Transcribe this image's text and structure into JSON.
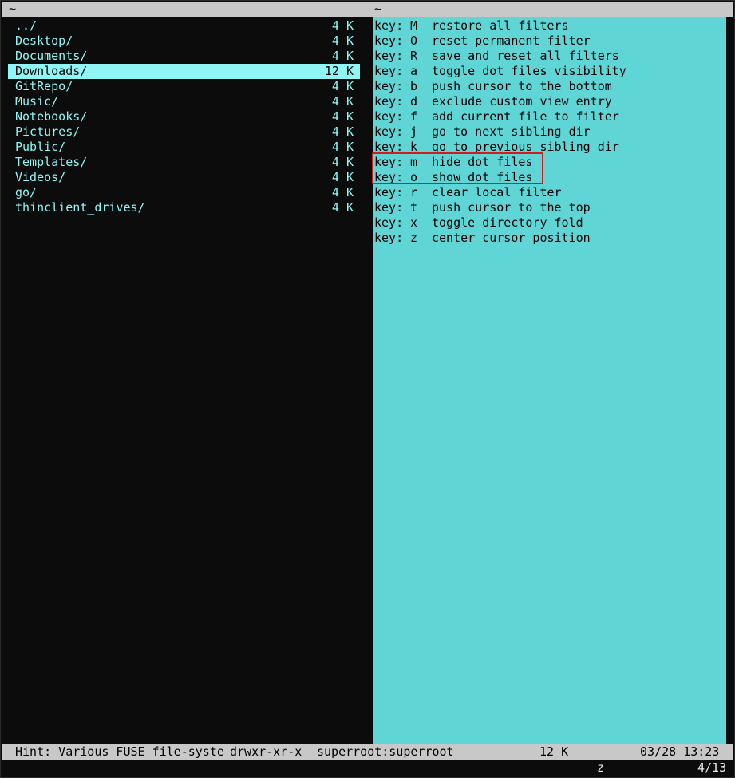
{
  "titlebar": {
    "left_path": "~",
    "right_path": "~"
  },
  "files": [
    {
      "name": "../",
      "size": "4 K"
    },
    {
      "name": "Desktop/",
      "size": "4 K"
    },
    {
      "name": "Documents/",
      "size": "4 K"
    },
    {
      "name": "Downloads/",
      "size": "12 K",
      "selected": true
    },
    {
      "name": "GitRepo/",
      "size": "4 K"
    },
    {
      "name": "Music/",
      "size": "4 K"
    },
    {
      "name": "Notebooks/",
      "size": "4 K"
    },
    {
      "name": "Pictures/",
      "size": "4 K"
    },
    {
      "name": "Public/",
      "size": "4 K"
    },
    {
      "name": "Templates/",
      "size": "4 K"
    },
    {
      "name": "Videos/",
      "size": "4 K"
    },
    {
      "name": "go/",
      "size": "4 K"
    },
    {
      "name": "thinclient_drives/",
      "size": "4 K"
    }
  ],
  "keys": [
    {
      "prefix": "key:",
      "key": "M",
      "desc": "restore all filters"
    },
    {
      "prefix": "key:",
      "key": "O",
      "desc": "reset permanent filter"
    },
    {
      "prefix": "key:",
      "key": "R",
      "desc": "save and reset all filters"
    },
    {
      "prefix": "key:",
      "key": "a",
      "desc": "toggle dot files visibility"
    },
    {
      "prefix": "key:",
      "key": "b",
      "desc": "push cursor to the bottom"
    },
    {
      "prefix": "key:",
      "key": "d",
      "desc": "exclude custom view entry"
    },
    {
      "prefix": "key:",
      "key": "f",
      "desc": "add current file to filter"
    },
    {
      "prefix": "key:",
      "key": "j",
      "desc": "go to next sibling dir"
    },
    {
      "prefix": "key:",
      "key": "k",
      "desc": "go to previous sibling dir"
    },
    {
      "prefix": "key:",
      "key": "m",
      "desc": "hide dot files"
    },
    {
      "prefix": "key:",
      "key": "o",
      "desc": "show dot files"
    },
    {
      "prefix": "key:",
      "key": "r",
      "desc": "clear local filter"
    },
    {
      "prefix": "key:",
      "key": "t",
      "desc": "push cursor to the top"
    },
    {
      "prefix": "key:",
      "key": "x",
      "desc": "toggle directory fold"
    },
    {
      "prefix": "key:",
      "key": "z",
      "desc": "center cursor position"
    }
  ],
  "status": {
    "hint": "Hint: Various FUSE file-syste",
    "permissions": "drwxr-xr-x",
    "owner": "superroot:superroot",
    "size": "12 K",
    "date": "03/28 13:23"
  },
  "bottom": {
    "pending_key": "z",
    "position": "4/13"
  },
  "colors": {
    "file_fg": "#8ff5f5",
    "selection_bg": "#8ff5f5",
    "keys_pane_bg": "#5fd5d5",
    "highlight_box": "#d01c1c",
    "bar_bg": "#c8c8c8"
  }
}
